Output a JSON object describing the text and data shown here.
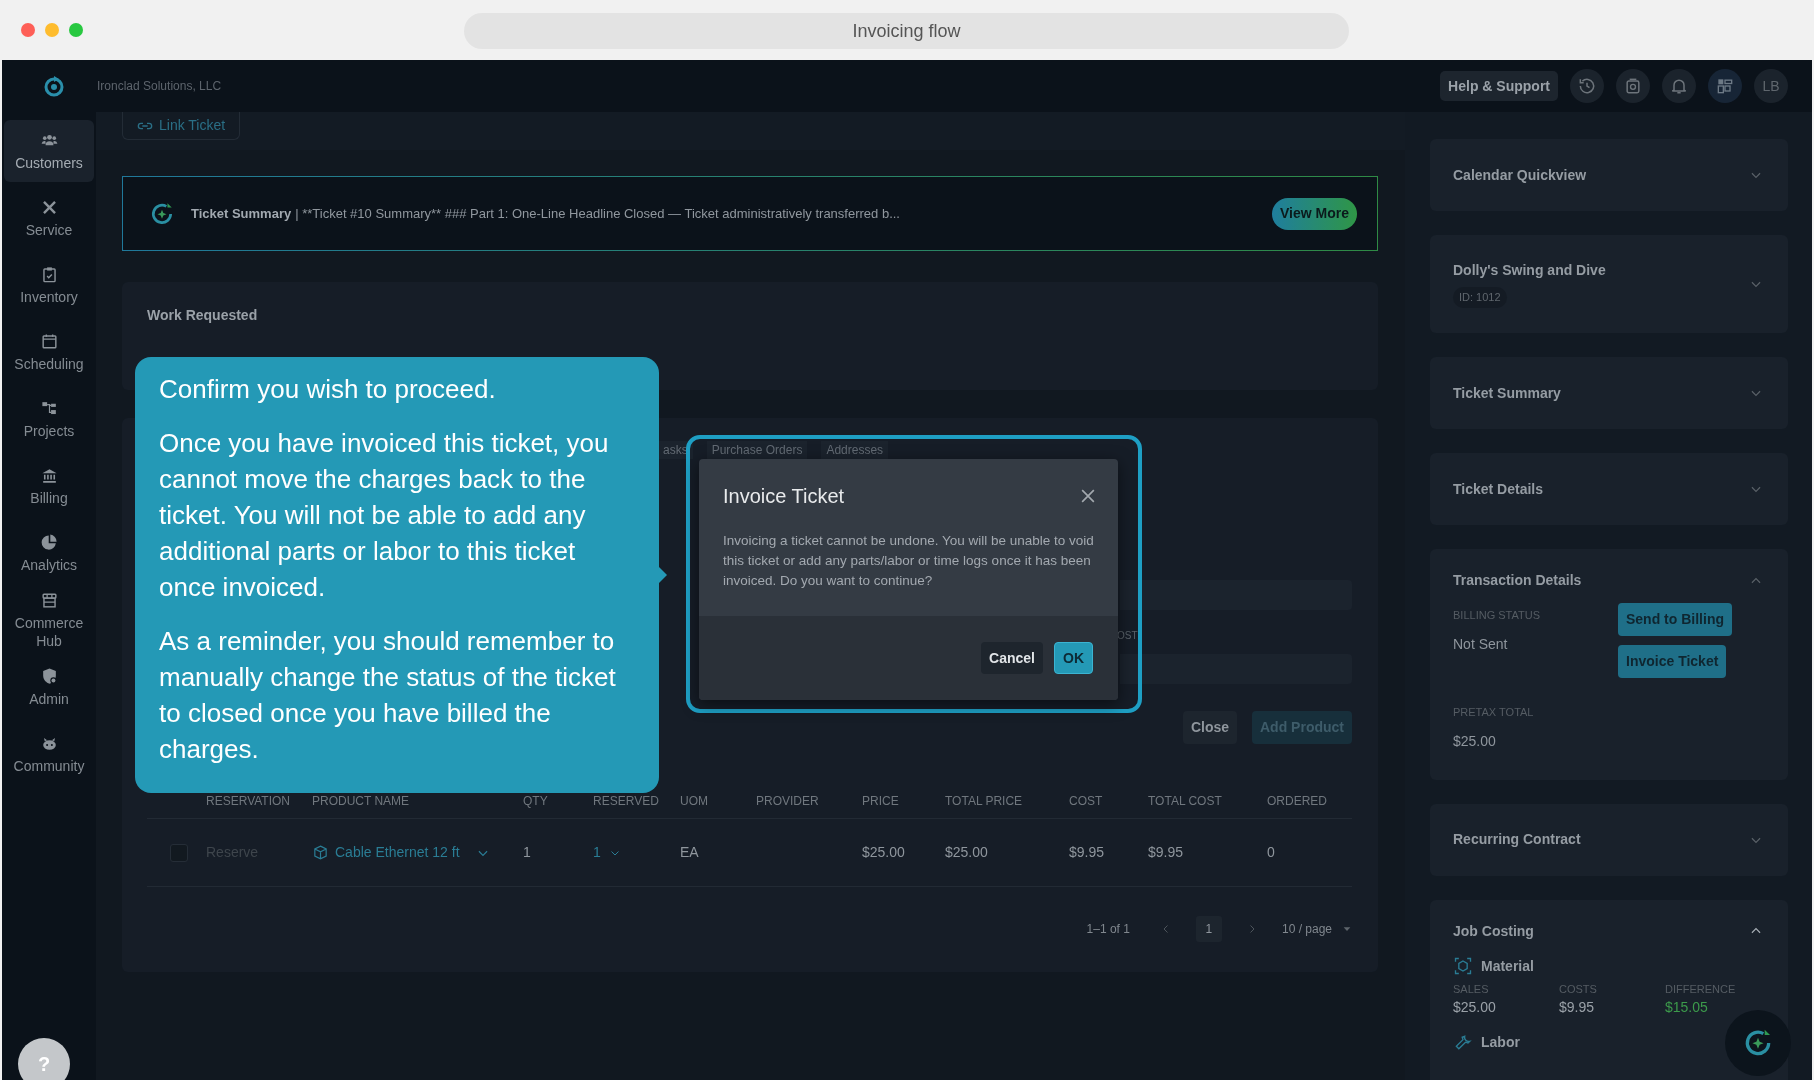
{
  "window": {
    "title": "Invoicing flow"
  },
  "header": {
    "company": "Ironclad Solutions, LLC",
    "help_button": "Help & Support",
    "avatar": "LB"
  },
  "sidebar": {
    "items": [
      {
        "label": "Customers",
        "selected": true
      },
      {
        "label": "Service",
        "selected": false
      },
      {
        "label": "Inventory",
        "selected": false
      },
      {
        "label": "Scheduling",
        "selected": false
      },
      {
        "label": "Projects",
        "selected": false
      },
      {
        "label": "Billing",
        "selected": false
      },
      {
        "label": "Analytics",
        "selected": false
      },
      {
        "label": "Commerce Hub",
        "selected": false
      },
      {
        "label": "Admin",
        "selected": false
      },
      {
        "label": "Community",
        "selected": false
      }
    ]
  },
  "help_bubble": "?",
  "main": {
    "link_ticket": "Link Ticket",
    "summary_banner": {
      "title": "Ticket Summary",
      "text": "| **Ticket #10 Summary** ### Part 1: One-Line Headline Closed — Ticket administratively transferred b...",
      "button": "View More"
    },
    "work_requested": "Work Requested",
    "tabs": [
      {
        "label": "asks"
      },
      {
        "label": "Purchase Orders"
      },
      {
        "label": "Addresses"
      }
    ],
    "field_label": "OST",
    "buttons": [
      {
        "label": "Close",
        "disabled": false
      },
      {
        "label": "Add Product",
        "disabled": true
      }
    ],
    "table": {
      "columns": [
        "RESERVATION",
        "PRODUCT NAME",
        "QTY",
        "RESERVED",
        "UOM",
        "PROVIDER",
        "PRICE",
        "TOTAL PRICE",
        "COST",
        "TOTAL COST",
        "ORDERED"
      ],
      "rows": [
        {
          "checked": false,
          "reservation": "Reserve",
          "product_name": "Cable Ethernet 12 ft",
          "qty": "1",
          "reserved": "1",
          "uom": "EA",
          "price": "$25.00",
          "total_price": "$25.00",
          "cost": "$9.95",
          "total_cost": "$9.95",
          "ordered": "0"
        }
      ]
    },
    "pagination": {
      "range": "1–1 of 1",
      "page": "1",
      "page_size": "10 / page"
    }
  },
  "tooltip": {
    "title": "Confirm you wish to proceed.",
    "paragraphs": [
      "Once you have invoiced this ticket, you cannot move the charges back to the ticket. You will not be able to add any additional parts or labor to this ticket once invoiced.",
      "As a reminder, you should remember to manually change the status of the ticket to closed once you have billed the charges."
    ]
  },
  "dialog": {
    "title": "Invoice Ticket",
    "message": "Invoicing a ticket cannot be undone. You will be unable to void this ticket or add any parts/labor or time logs once it has been invoiced. Do you want to continue?",
    "buttons": [
      {
        "label": "Cancel",
        "kind": "secondary"
      },
      {
        "label": "OK",
        "kind": "primary"
      }
    ]
  },
  "right_panel": {
    "sections": [
      {
        "kind": "plain",
        "title": "Calendar Quickview",
        "expanded": false
      },
      {
        "kind": "customer",
        "title": "Dolly's Swing and Dive",
        "badge": "ID: 1012",
        "expanded": false
      },
      {
        "kind": "plain",
        "title": "Ticket Summary",
        "expanded": false
      },
      {
        "kind": "plain",
        "title": "Ticket Details",
        "expanded": false
      },
      {
        "kind": "transaction",
        "title": "Transaction Details",
        "expanded": true,
        "billing_status_label": "BILLING STATUS",
        "billing_status": "Not Sent",
        "actions": [
          "Send to Billing",
          "Invoice Ticket"
        ],
        "pretax_label": "PRETAX TOTAL",
        "pretax": "$25.00"
      },
      {
        "kind": "plain",
        "title": "Recurring Contract",
        "expanded": false
      },
      {
        "kind": "job_costing",
        "title": "Job Costing",
        "expanded": true,
        "groups": [
          {
            "kind": "material",
            "name": "Material",
            "metrics": [
              {
                "label": "SALES",
                "value": "$25.00",
                "color": "#9aa1a8"
              },
              {
                "label": "COSTS",
                "value": "$9.95",
                "color": "#9aa1a8"
              },
              {
                "label": "DIFFERENCE",
                "value": "$15.05",
                "color": "#3c9a4b"
              }
            ]
          },
          {
            "kind": "labor",
            "name": "Labor"
          }
        ]
      }
    ]
  }
}
